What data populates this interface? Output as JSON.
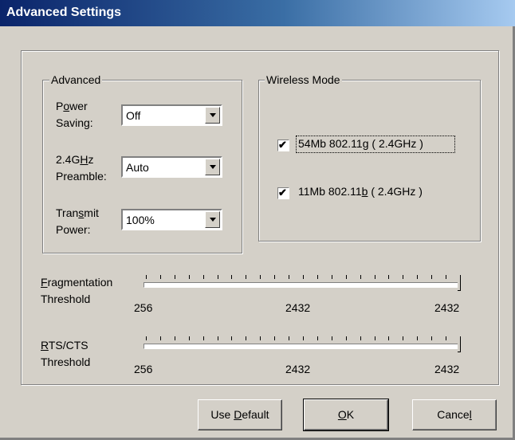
{
  "window": {
    "title": "Advanced Settings"
  },
  "advanced": {
    "legend": "Advanced",
    "power_saving": {
      "label_1": "Power",
      "label_1_mnemonic": "o",
      "label_2": "Saving:",
      "value": "Off"
    },
    "preamble": {
      "label_1": "2.4GHz",
      "label_1_mnemonic": "H",
      "label_2": "Preamble:",
      "value": "Auto"
    },
    "transmit_power": {
      "label_1": "Transmit",
      "label_1_mnemonic": "s",
      "label_2": "Power:",
      "value": "100%"
    }
  },
  "wireless_mode": {
    "legend": "Wireless Mode",
    "options": [
      {
        "label_pre": "54Mb 802.11",
        "mnemonic": "g",
        "label_post": " ( 2.4GHz )",
        "checked": true,
        "focused": true
      },
      {
        "label_pre": "11Mb 802.11",
        "mnemonic": "b",
        "label_post": " ( 2.4GHz )",
        "checked": true,
        "focused": false
      }
    ]
  },
  "fragmentation": {
    "label_1": "Fragmentation",
    "label_1_mnemonic": "F",
    "label_2": "Threshold",
    "min": "256",
    "current": "2432",
    "max": "2432",
    "level": 1.0
  },
  "rts_cts": {
    "label_1": "RTS/CTS",
    "label_1_mnemonic": "R",
    "label_2": "Threshold",
    "min": "256",
    "current": "2432",
    "max": "2432",
    "level": 1.0
  },
  "buttons": {
    "use_default": {
      "pre": "Use ",
      "mnemonic": "D",
      "post": "efault"
    },
    "ok": {
      "pre": "",
      "mnemonic": "O",
      "post": "K"
    },
    "cancel": {
      "pre": "Cance",
      "mnemonic": "l",
      "post": ""
    }
  },
  "colors": {
    "titlebar_start": "#0a246a",
    "titlebar_end": "#a6caf0",
    "face": "#d4d0c8"
  }
}
